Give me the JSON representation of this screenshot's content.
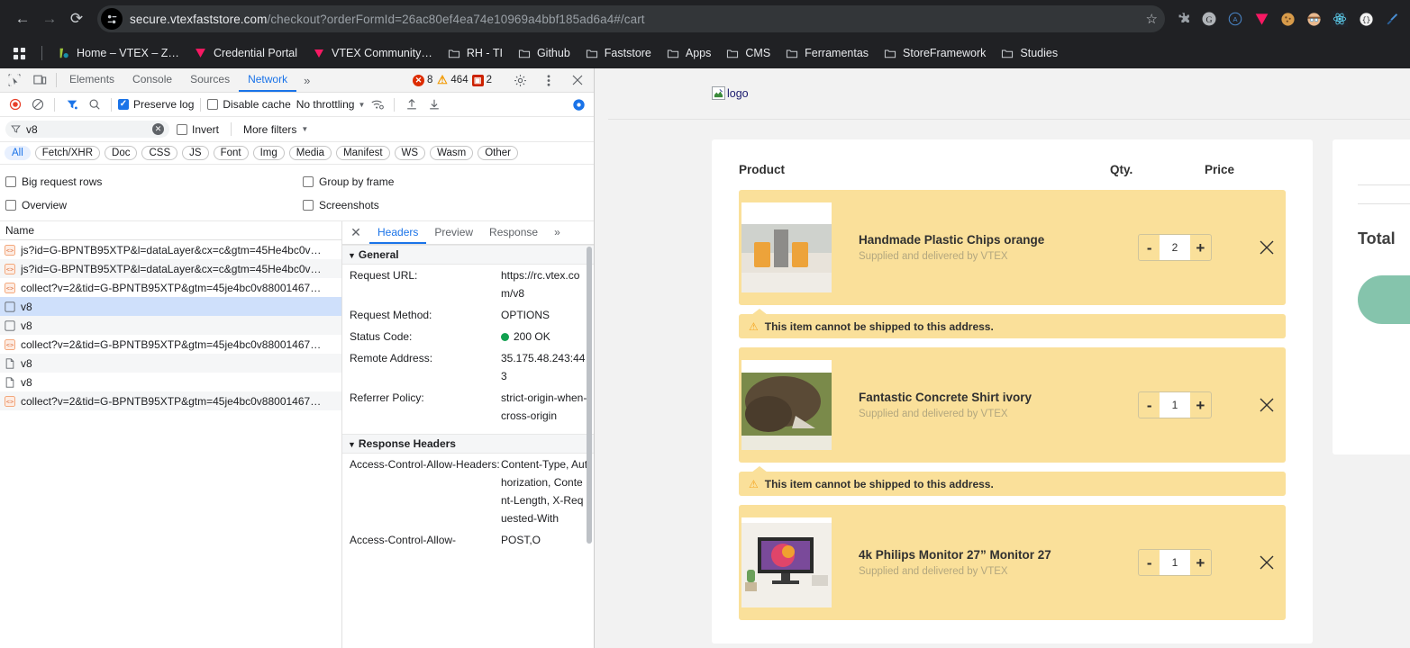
{
  "browser": {
    "nav": {
      "back": "←",
      "forward": "→",
      "reload": "⟳"
    },
    "url_host": "secure.vtexfaststore.com",
    "url_path": "/checkout?orderFormId=26ac80ef4ea74e10969a4bbf185ad6a4#/cart",
    "star": "☆",
    "extensions": [
      {
        "name": "puzzle-extensions-icon",
        "glyph": "🧩"
      },
      {
        "name": "grammarly-icon",
        "glyph": "Ⓖ"
      },
      {
        "name": "axe-devtools-icon",
        "glyph": "Ⓐ"
      },
      {
        "name": "vtex-icon",
        "glyph": "▼"
      },
      {
        "name": "cookie-editor-icon",
        "glyph": "🍪"
      },
      {
        "name": "avatar-extension-icon",
        "glyph": "🧑"
      },
      {
        "name": "react-devtools-icon",
        "glyph": "⚛"
      },
      {
        "name": "json-viewer-icon",
        "glyph": "◌"
      },
      {
        "name": "eyedropper-icon",
        "glyph": "✒"
      }
    ],
    "bookmarks": [
      {
        "label": "Home – VTEX – Z…",
        "icon": "vtex-io-icon",
        "glyph": "▮"
      },
      {
        "label": "Credential Portal",
        "icon": "vtex-icon",
        "glyph": "▼"
      },
      {
        "label": "VTEX Community…",
        "icon": "vtex-icon",
        "glyph": "▼"
      },
      {
        "label": "RH - TI",
        "icon": "folder-icon",
        "glyph": "🗀"
      },
      {
        "label": "Github",
        "icon": "folder-icon",
        "glyph": "🗀"
      },
      {
        "label": "Faststore",
        "icon": "folder-icon",
        "glyph": "🗀"
      },
      {
        "label": "Apps",
        "icon": "folder-icon",
        "glyph": "🗀"
      },
      {
        "label": "CMS",
        "icon": "folder-icon",
        "glyph": "🗀"
      },
      {
        "label": "Ferramentas",
        "icon": "folder-icon",
        "glyph": "🗀"
      },
      {
        "label": "StoreFramework",
        "icon": "folder-icon",
        "glyph": "🗀"
      },
      {
        "label": "Studies",
        "icon": "folder-icon",
        "glyph": "🗀"
      }
    ]
  },
  "devtools": {
    "tabs": [
      {
        "label": "Elements",
        "active": false
      },
      {
        "label": "Console",
        "active": false
      },
      {
        "label": "Sources",
        "active": false
      },
      {
        "label": "Network",
        "active": true
      }
    ],
    "more_tabs": "»",
    "counts": {
      "errors": "8",
      "warnings": "464",
      "messages": "2"
    },
    "toolbar": {
      "record_title": "record-button",
      "clear_title": "clear-button",
      "filter_title": "filter-button",
      "search_title": "search-button",
      "preserve_log": "Preserve log",
      "preserve_log_checked": true,
      "disable_cache": "Disable cache",
      "disable_cache_checked": false,
      "throttling": "No throttling",
      "import_title": "import-har",
      "export_title": "export-har",
      "settings_title": "network-settings"
    },
    "filter": {
      "value": "v8",
      "invert_label": "Invert",
      "invert_checked": false,
      "more_filters": "More filters"
    },
    "types": [
      "All",
      "Fetch/XHR",
      "Doc",
      "CSS",
      "JS",
      "Font",
      "Img",
      "Media",
      "Manifest",
      "WS",
      "Wasm",
      "Other"
    ],
    "active_type": "All",
    "options": {
      "big_request_rows": "Big request rows",
      "group_by_frame": "Group by frame",
      "overview": "Overview",
      "screenshots": "Screenshots"
    },
    "requests_header": "Name",
    "requests": [
      {
        "name": "js?id=G-BPNTB95XTP&l=dataLayer&cx=c&gtm=45He4bc0v…",
        "kind": "js",
        "selected": false
      },
      {
        "name": "js?id=G-BPNTB95XTP&l=dataLayer&cx=c&gtm=45He4bc0v…",
        "kind": "js",
        "selected": false
      },
      {
        "name": "collect?v=2&tid=G-BPNTB95XTP&gtm=45je4bc0v88001467…",
        "kind": "js",
        "selected": false
      },
      {
        "name": "v8",
        "kind": "xhr",
        "selected": true
      },
      {
        "name": "v8",
        "kind": "xhr",
        "selected": false
      },
      {
        "name": "collect?v=2&tid=G-BPNTB95XTP&gtm=45je4bc0v88001467…",
        "kind": "js",
        "selected": false
      },
      {
        "name": "v8",
        "kind": "doc",
        "selected": false
      },
      {
        "name": "v8",
        "kind": "doc",
        "selected": false
      },
      {
        "name": "collect?v=2&tid=G-BPNTB95XTP&gtm=45je4bc0v88001467…",
        "kind": "js",
        "selected": false
      }
    ],
    "detail": {
      "close": "✕",
      "tabs": [
        {
          "label": "Headers",
          "active": true
        },
        {
          "label": "Preview",
          "active": false
        },
        {
          "label": "Response",
          "active": false
        }
      ],
      "more": "»",
      "general_title": "General",
      "general": [
        {
          "key": "Request URL:",
          "value": "https://rc.vtex.com/v8"
        },
        {
          "key": "Request Method:",
          "value": "OPTIONS"
        },
        {
          "key": "Status Code:",
          "value": "200 OK",
          "dot": true
        },
        {
          "key": "Remote Address:",
          "value": "35.175.48.243:443"
        },
        {
          "key": "Referrer Policy:",
          "value": "strict-origin-when-cross-origin"
        }
      ],
      "response_headers_title": "Response Headers",
      "response_headers": [
        {
          "key": "Access-Control-Allow-Headers:",
          "value": "Content-Type, Authorization, Content-Length, X-Requested-With"
        },
        {
          "key": "Access-Control-Allow-",
          "value": "POST,O"
        }
      ]
    }
  },
  "checkout": {
    "logo_alt": "logo",
    "columns": {
      "product": "Product",
      "qty": "Qty.",
      "price": "Price"
    },
    "items": [
      {
        "title": "Handmade Plastic Chips orange",
        "subtitle": "Supplied and delivered by VTEX",
        "qty": "2",
        "minus": "-",
        "plus": "+",
        "remove": "✕",
        "warning": "This item cannot be shipped to this address."
      },
      {
        "title": "Fantastic Concrete Shirt ivory",
        "subtitle": "Supplied and delivered by VTEX",
        "qty": "1",
        "minus": "-",
        "plus": "+",
        "remove": "✕",
        "warning": "This item cannot be shipped to this address."
      },
      {
        "title": "4k Philips Monitor 27” Monitor 27",
        "subtitle": "Supplied and delivered by VTEX",
        "qty": "1",
        "minus": "-",
        "plus": "+",
        "remove": "✕",
        "warning": ""
      }
    ],
    "summary": {
      "total_label": "Total"
    },
    "colors": {
      "item_bg": "#fae09a",
      "cta": "#85c4ac",
      "warn_icon": "#f5a623"
    }
  }
}
